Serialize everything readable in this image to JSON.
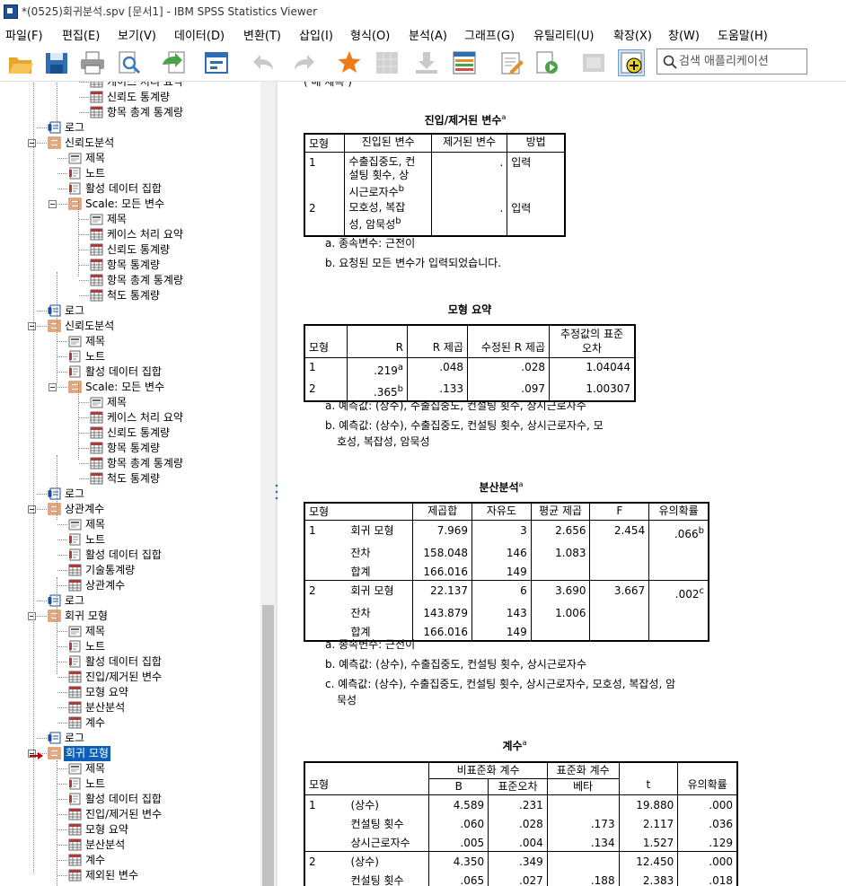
{
  "window": {
    "title": "*(0525)회귀분석.spv [문서1] - IBM SPSS Statistics Viewer"
  },
  "menu": [
    "파일(F)",
    "편집(E)",
    "보기(V)",
    "데이터(D)",
    "변환(T)",
    "삽입(I)",
    "형식(O)",
    "분석(A)",
    "그래프(G)",
    "유틸리티(U)",
    "확장(X)",
    "창(W)",
    "도움말(H)"
  ],
  "toolbar": {
    "icons": [
      "open-icon",
      "save-icon",
      "print-icon",
      "print-preview-icon",
      "export-icon",
      "recall-dialog-icon",
      "undo-icon",
      "redo-icon",
      "goto-data-icon",
      "goto-case-icon",
      "goto-variable-icon",
      "variables-icon",
      "designate-window-icon",
      "show-all-icon",
      "hide-icon",
      "output-off-icon",
      "insert-new-icon"
    ],
    "search_placeholder": "검색 애플리케이션"
  },
  "outline": [
    {
      "level": 3,
      "label": "케이스 처리 요약",
      "icon": "table"
    },
    {
      "level": 3,
      "label": "신뢰도 통계량",
      "icon": "table"
    },
    {
      "level": 3,
      "label": "항목 총계 통계량",
      "icon": "table"
    },
    {
      "level": 1,
      "label": "로그",
      "icon": "log"
    },
    {
      "level": 1,
      "label": "신뢰도분석",
      "icon": "folder",
      "exp": true
    },
    {
      "level": 2,
      "label": "제목",
      "icon": "title"
    },
    {
      "level": 2,
      "label": "노트",
      "icon": "notes"
    },
    {
      "level": 2,
      "label": "활성 데이터 집합",
      "icon": "notes"
    },
    {
      "level": 2,
      "label": "Scale: 모든 변수",
      "icon": "folder",
      "exp": true
    },
    {
      "level": 3,
      "label": "제목",
      "icon": "title"
    },
    {
      "level": 3,
      "label": "케이스 처리 요약",
      "icon": "table"
    },
    {
      "level": 3,
      "label": "신뢰도 통계량",
      "icon": "table"
    },
    {
      "level": 3,
      "label": "항목 통계량",
      "icon": "table"
    },
    {
      "level": 3,
      "label": "항목 총계 통계량",
      "icon": "table"
    },
    {
      "level": 3,
      "label": "척도 통계량",
      "icon": "table"
    },
    {
      "level": 1,
      "label": "로그",
      "icon": "log"
    },
    {
      "level": 1,
      "label": "신뢰도분석",
      "icon": "folder",
      "exp": true
    },
    {
      "level": 2,
      "label": "제목",
      "icon": "title"
    },
    {
      "level": 2,
      "label": "노트",
      "icon": "notes"
    },
    {
      "level": 2,
      "label": "활성 데이터 집합",
      "icon": "notes"
    },
    {
      "level": 2,
      "label": "Scale: 모든 변수",
      "icon": "folder",
      "exp": true
    },
    {
      "level": 3,
      "label": "제목",
      "icon": "title"
    },
    {
      "level": 3,
      "label": "케이스 처리 요약",
      "icon": "table"
    },
    {
      "level": 3,
      "label": "신뢰도 통계량",
      "icon": "table"
    },
    {
      "level": 3,
      "label": "항목 통계량",
      "icon": "table"
    },
    {
      "level": 3,
      "label": "항목 총계 통계량",
      "icon": "table"
    },
    {
      "level": 3,
      "label": "척도 통계량",
      "icon": "table"
    },
    {
      "level": 1,
      "label": "로그",
      "icon": "log"
    },
    {
      "level": 1,
      "label": "상관계수",
      "icon": "folder",
      "exp": true
    },
    {
      "level": 2,
      "label": "제목",
      "icon": "title"
    },
    {
      "level": 2,
      "label": "노트",
      "icon": "notes"
    },
    {
      "level": 2,
      "label": "활성 데이터 집합",
      "icon": "notes"
    },
    {
      "level": 2,
      "label": "기술통계량",
      "icon": "table"
    },
    {
      "level": 2,
      "label": "상관계수",
      "icon": "table"
    },
    {
      "level": 1,
      "label": "로그",
      "icon": "log"
    },
    {
      "level": 1,
      "label": "회귀 모형",
      "icon": "folder",
      "exp": true
    },
    {
      "level": 2,
      "label": "제목",
      "icon": "title"
    },
    {
      "level": 2,
      "label": "노트",
      "icon": "notes"
    },
    {
      "level": 2,
      "label": "활성 데이터 집합",
      "icon": "notes"
    },
    {
      "level": 2,
      "label": "진입/제거된 변수",
      "icon": "table"
    },
    {
      "level": 2,
      "label": "모형 요약",
      "icon": "table"
    },
    {
      "level": 2,
      "label": "분산분석",
      "icon": "table"
    },
    {
      "level": 2,
      "label": "계수",
      "icon": "table"
    },
    {
      "level": 1,
      "label": "로그",
      "icon": "log"
    },
    {
      "level": 1,
      "label": "회귀 모형",
      "icon": "folder",
      "exp": true,
      "selected": true
    },
    {
      "level": 2,
      "label": "제목",
      "icon": "title"
    },
    {
      "level": 2,
      "label": "노트",
      "icon": "notes"
    },
    {
      "level": 2,
      "label": "활성 데이터 집합",
      "icon": "notes"
    },
    {
      "level": 2,
      "label": "진입/제거된 변수",
      "icon": "table"
    },
    {
      "level": 2,
      "label": "모형 요약",
      "icon": "table"
    },
    {
      "level": 2,
      "label": "분산분석",
      "icon": "table"
    },
    {
      "level": 2,
      "label": "계수",
      "icon": "table"
    },
    {
      "level": 2,
      "label": "제외된 변수",
      "icon": "table"
    }
  ],
  "entered": {
    "title": "진입/제거된 변수",
    "title_sup": "a",
    "headers": [
      "모형",
      "진입된 변수",
      "제거된 변수",
      "방법"
    ],
    "rows": [
      {
        "model": "1",
        "entered": [
          "수출집중도, 컨",
          "설팅 횟수, 상",
          "시근로자수"
        ],
        "sup": "b",
        "removed": ".",
        "method": "입력"
      },
      {
        "model": "2",
        "entered": [
          "모호성, 복잡",
          "성, 암묵성"
        ],
        "sup": "b",
        "removed": ".",
        "method": "입력"
      }
    ],
    "notes": [
      "a. 종속변수: 근전이",
      "b. 요청된 모든 변수가 입력되었습니다."
    ]
  },
  "model_summary": {
    "title": "모형 요약",
    "headers": [
      "모형",
      "R",
      "R 제곱",
      "수정된 R 제곱",
      "추정값의 표준",
      "오차"
    ],
    "rows": [
      {
        "model": "1",
        "r": ".219",
        "sup": "a",
        "r2": ".048",
        "adj": ".028",
        "se": "1.04044"
      },
      {
        "model": "2",
        "r": ".365",
        "sup": "b",
        "r2": ".133",
        "adj": ".097",
        "se": "1.00307"
      }
    ],
    "notes": [
      "a. 예측값: (상수), 수출집중도, 컨설팅 횟수, 상시근로자수",
      "b. 예측값: (상수), 수출집중도, 컨설팅 횟수, 상시근로자수, 모",
      "호성, 복잡성, 암묵성"
    ]
  },
  "anova": {
    "title": "분산분석",
    "title_sup": "a",
    "headers": [
      "모형",
      "제곱합",
      "자유도",
      "평균 제곱",
      "F",
      "유의확률"
    ],
    "rows": [
      {
        "model": "1",
        "src": "회귀 모형",
        "ss": "7.969",
        "df": "3",
        "ms": "2.656",
        "f": "2.454",
        "sig": ".066",
        "sig_sup": "b"
      },
      {
        "model": "",
        "src": "잔차",
        "ss": "158.048",
        "df": "146",
        "ms": "1.083",
        "f": "",
        "sig": "",
        "sig_sup": ""
      },
      {
        "model": "",
        "src": "합계",
        "ss": "166.016",
        "df": "149",
        "ms": "",
        "f": "",
        "sig": "",
        "sig_sup": ""
      },
      {
        "model": "2",
        "src": "회귀 모형",
        "ss": "22.137",
        "df": "6",
        "ms": "3.690",
        "f": "3.667",
        "sig": ".002",
        "sig_sup": "c"
      },
      {
        "model": "",
        "src": "잔차",
        "ss": "143.879",
        "df": "143",
        "ms": "1.006",
        "f": "",
        "sig": "",
        "sig_sup": ""
      },
      {
        "model": "",
        "src": "합계",
        "ss": "166.016",
        "df": "149",
        "ms": "",
        "f": "",
        "sig": "",
        "sig_sup": ""
      }
    ],
    "notes": [
      "a. 종속변수: 근전이",
      "b. 예측값: (상수), 수출집중도, 컨설팅 횟수, 상시근로자수",
      "c. 예측값: (상수), 수출집중도, 컨설팅 횟수, 상시근로자수, 모호성, 복잡성, 암",
      "묵성"
    ]
  },
  "coef": {
    "title": "계수",
    "title_sup": "a",
    "header_group1": "비표준화 계수",
    "header_group2": "표준화 계수",
    "headers": [
      "모형",
      "B",
      "표준오차",
      "베타",
      "t",
      "유의확률"
    ],
    "rows": [
      {
        "model": "1",
        "var": "(상수)",
        "b": "4.589",
        "se": ".231",
        "beta": "",
        "t": "19.880",
        "sig": ".000"
      },
      {
        "model": "",
        "var": "컨설팅 횟수",
        "b": ".060",
        "se": ".028",
        "beta": ".173",
        "t": "2.117",
        "sig": ".036"
      },
      {
        "model": "",
        "var": "상시근로자수",
        "b": ".005",
        "se": ".004",
        "beta": ".134",
        "t": "1.527",
        "sig": ".129"
      },
      {
        "model": "2",
        "var": "(상수)",
        "b": "4.350",
        "se": ".349",
        "beta": "",
        "t": "12.450",
        "sig": ".000"
      },
      {
        "model": "",
        "var": "컨설팅 횟수",
        "b": ".065",
        "se": ".027",
        "beta": ".188",
        "t": "2.383",
        "sig": ".018"
      }
    ]
  },
  "top_partial_text": "( 배 제목 )"
}
